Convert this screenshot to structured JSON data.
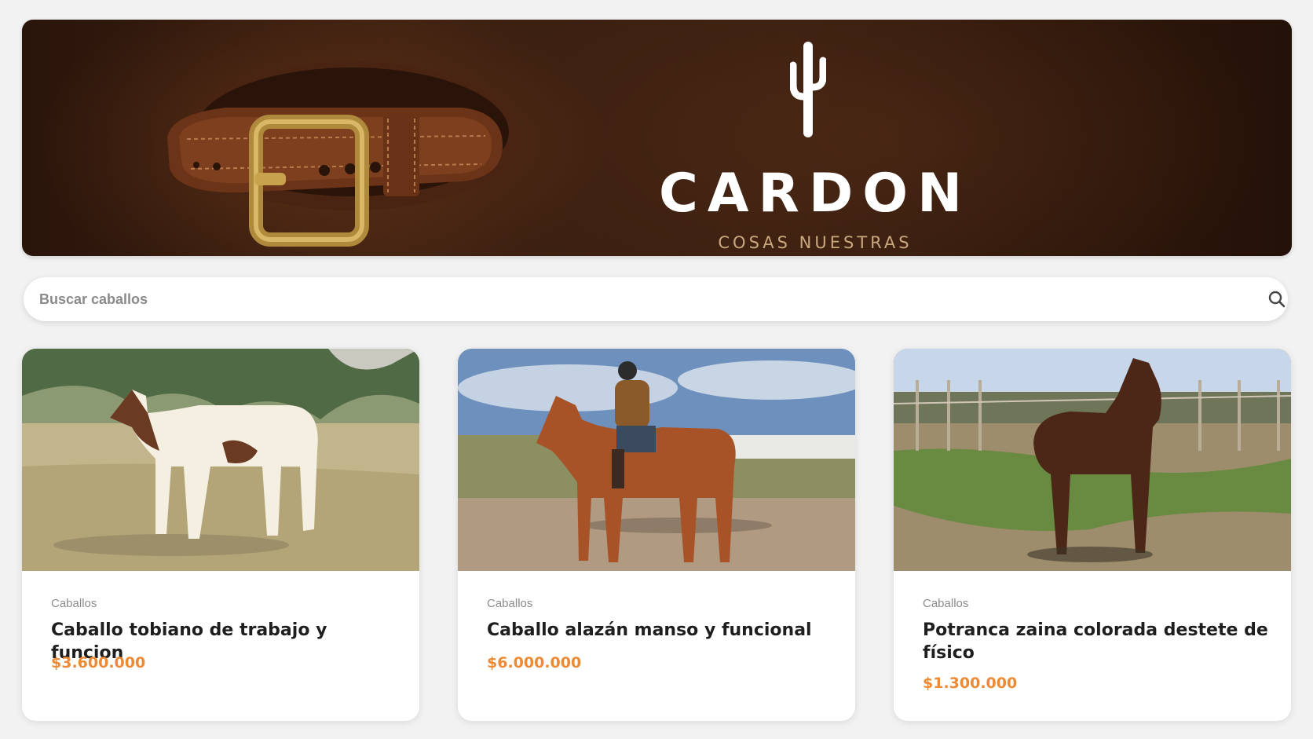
{
  "brand": {
    "name": "CARDON",
    "tagline": "COSAS NUESTRAS",
    "logo_icon": "cactus-icon",
    "colors": {
      "banner_bg": "#3a1f10",
      "tagline": "#c9a87f"
    }
  },
  "search": {
    "placeholder": "Buscar caballos",
    "icon": "search-icon"
  },
  "listings": [
    {
      "category": "Caballos",
      "title": "Caballo tobiano de trabajo y funcion",
      "price": "$3.600.000"
    },
    {
      "category": "Caballos",
      "title": "Caballo alazán manso y funcional",
      "price": "$6.000.000"
    },
    {
      "category": "Caballos",
      "title": "Potranca zaina colorada destete de físico",
      "price": "$1.300.000"
    }
  ],
  "colors": {
    "price": "#ec8a35",
    "page_bg": "#f2f2f2"
  }
}
